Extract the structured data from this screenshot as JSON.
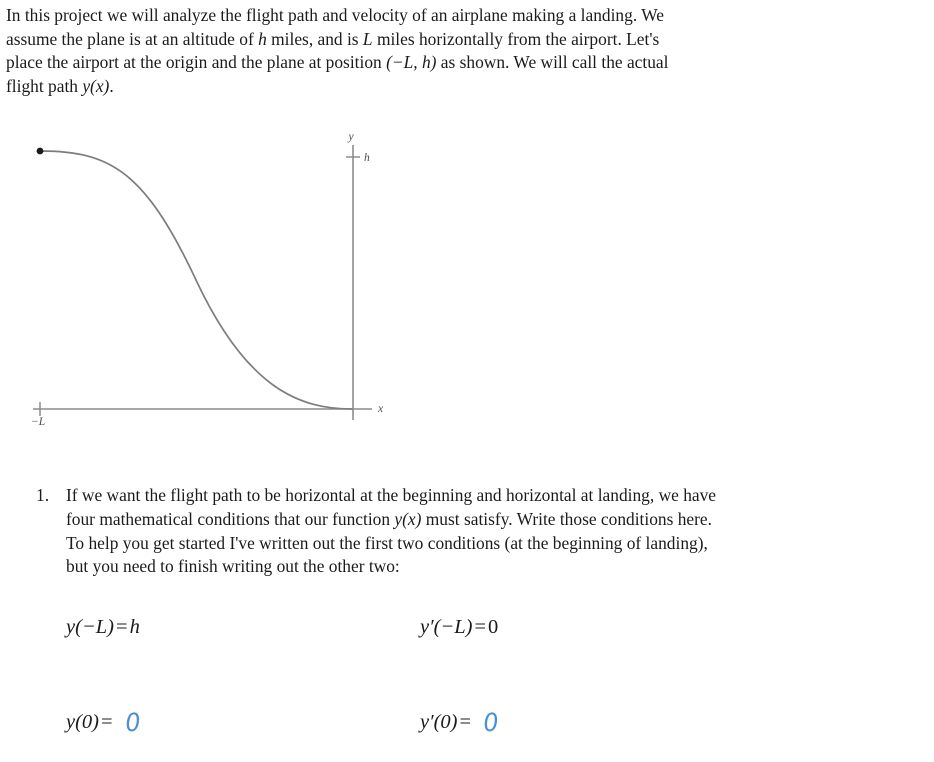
{
  "document": {
    "type": "math-worksheet",
    "background_color": "#ffffff",
    "text_color": "#1b1b1b",
    "annotation_color": "#4a90d9"
  },
  "intro": {
    "line1": "In this project we will analyze the flight path and velocity of an airplane making a landing.  We",
    "line2_a": "assume the plane is at an altitude of ",
    "line2_h": "h",
    "line2_b": " miles, and is ",
    "line2_L": "L",
    "line2_c": " miles horizontally from the airport.  Let's",
    "line3_a": "place the airport at the origin and the plane at position ",
    "line3_pos": "(−L, h)",
    "line3_b": " as shown.  We will call the actual",
    "line4_a": "flight path ",
    "line4_y": "y(x)",
    "line4_b": "."
  },
  "figure": {
    "name": "flight-path-diagram",
    "caption": "",
    "axis_labels": {
      "y_axis": "y",
      "x_axis": "x",
      "height_tick": "h",
      "origin_offset_tick": "−L"
    },
    "colors": {
      "axis": "#8c8c8c",
      "curve": "#7d7d7d",
      "point": "#1a1a1a"
    },
    "start_point_label": "(−L, h)"
  },
  "chart_data": {
    "type": "line",
    "title": "",
    "xlabel": "x",
    "ylabel": "y",
    "xlim": [
      -1.0,
      0.08
    ],
    "ylim": [
      0,
      1.12
    ],
    "grid": false,
    "legend": null,
    "annotations": [
      {
        "text": "h",
        "x": 0.0,
        "y": 1.0,
        "kind": "axis-tick"
      },
      {
        "text": "−L",
        "x": -1.0,
        "y": 0.0,
        "kind": "axis-tick"
      },
      {
        "text": "y",
        "x": 0.0,
        "y": 1.12,
        "kind": "axis-name"
      },
      {
        "text": "x",
        "x": 0.06,
        "y": 0.0,
        "kind": "axis-name"
      }
    ],
    "markers": [
      {
        "x": -1.0,
        "y": 1.0,
        "label": "plane start",
        "style": "filled-dot"
      }
    ],
    "series": [
      {
        "name": "flight path y(x)",
        "description": "cubic y = h(2t^3 - 3t^2 + 1) with t = 1 + x/L, zero slope at x=-L and x=0",
        "x": [
          -1.0,
          -0.9,
          -0.8,
          -0.7,
          -0.6,
          -0.5,
          -0.4,
          -0.3,
          -0.2,
          -0.1,
          0.0
        ],
        "y": [
          1.0,
          0.972,
          0.896,
          0.784,
          0.648,
          0.5,
          0.352,
          0.216,
          0.104,
          0.028,
          0.0
        ]
      }
    ]
  },
  "question": {
    "number": "1.",
    "line1": "If we want the flight path to be horizontal at the beginning and horizontal at landing, we have",
    "line2_a": "four mathematical conditions that our function ",
    "line2_y": "y(x)",
    "line2_b": " must satisfy.  Write those conditions here.",
    "line3": "To help you get started I've written out the first two conditions (at the beginning of landing),",
    "line4": "but you need to finish writing out the other two:"
  },
  "equations": {
    "row1": {
      "left": {
        "name": "condition-y-at-minus-L",
        "lhs_fn": "y",
        "lhs_arg": "(−L)",
        "equals": "=",
        "rhs": "h",
        "handwritten": false
      },
      "right": {
        "name": "condition-yprime-at-minus-L",
        "lhs_fn": "y′",
        "lhs_arg": "(−L)",
        "equals": "=",
        "rhs": "0",
        "handwritten": false
      }
    },
    "row2": {
      "left": {
        "name": "condition-y-at-zero",
        "lhs_fn": "y",
        "lhs_arg": "(0)",
        "equals": "=",
        "rhs": "0",
        "handwritten": true
      },
      "right": {
        "name": "condition-yprime-at-zero",
        "lhs_fn": "y′",
        "lhs_arg": "(0)",
        "equals": "=",
        "rhs": "0",
        "handwritten": true
      }
    }
  }
}
